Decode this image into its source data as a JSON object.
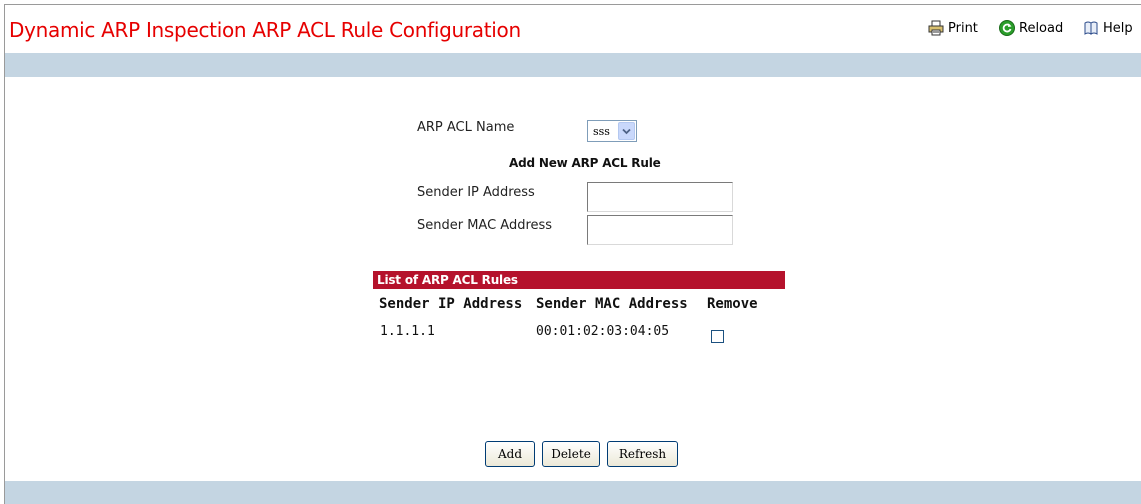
{
  "header": {
    "title": "Dynamic ARP Inspection ARP ACL Rule Configuration",
    "tools": {
      "print": "Print",
      "reload": "Reload",
      "help": "Help"
    }
  },
  "form": {
    "acl_name_label": "ARP ACL Name",
    "acl_name_value": "sss",
    "add_rule_heading": "Add New ARP ACL Rule",
    "sender_ip_label": "Sender IP Address",
    "sender_ip_value": "",
    "sender_mac_label": "Sender MAC Address",
    "sender_mac_value": ""
  },
  "rules_list": {
    "heading": "List of ARP ACL Rules",
    "columns": [
      "Sender IP Address",
      "Sender MAC Address",
      "Remove"
    ],
    "rows": [
      {
        "sender_ip": "1.1.1.1",
        "sender_mac": "00:01:02:03:04:05",
        "remove_checked": false
      }
    ]
  },
  "buttons": {
    "add": "Add",
    "delete": "Delete",
    "refresh": "Refresh"
  },
  "colors": {
    "title": "#e60000",
    "band": "#c4d5e2",
    "list_header": "#b5122c"
  },
  "icons": {
    "print": "printer-icon",
    "reload": "reload-icon",
    "help": "help-book-icon",
    "dropdown": "chevron-down-icon"
  }
}
